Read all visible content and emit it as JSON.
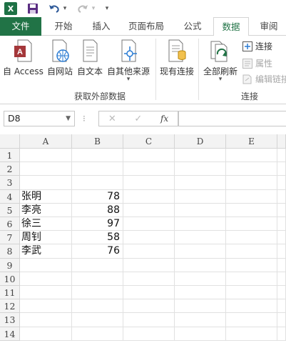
{
  "quick_access": {
    "undo_arrow": "▾",
    "more": "▾"
  },
  "tabs": [
    "文件",
    "开始",
    "插入",
    "页面布局",
    "公式",
    "数据",
    "审阅"
  ],
  "ribbon": {
    "get_external": {
      "buttons": [
        "自 Access",
        "自网站",
        "自文本",
        "自其他来源"
      ],
      "group_label": "获取外部数据"
    },
    "existing": "现有连接",
    "refresh_all": "全部刷新",
    "connections": {
      "items": [
        "连接",
        "属性",
        "编辑链接"
      ],
      "group_label": "连接"
    },
    "colors": {
      "accent": "#217346",
      "access_red": "#a4373a",
      "web_blue": "#2b7cd3"
    }
  },
  "formula_bar": {
    "name_box": "D8",
    "fx": "fx",
    "cancel": "✕",
    "enter": "✓",
    "colon": "⁝",
    "formula": ""
  },
  "columns": [
    "A",
    "B",
    "C",
    "D",
    "E"
  ],
  "rows": [
    "1",
    "2",
    "3",
    "4",
    "5",
    "6",
    "7",
    "8",
    "9",
    "10",
    "11",
    "12",
    "13",
    "14"
  ],
  "cells": [
    {
      "row": 4,
      "name": "张明",
      "score": "78"
    },
    {
      "row": 5,
      "name": "李亮",
      "score": "88"
    },
    {
      "row": 6,
      "name": "徐三",
      "score": "97"
    },
    {
      "row": 7,
      "name": "周钊",
      "score": "58"
    },
    {
      "row": 8,
      "name": "李武",
      "score": "76"
    }
  ]
}
